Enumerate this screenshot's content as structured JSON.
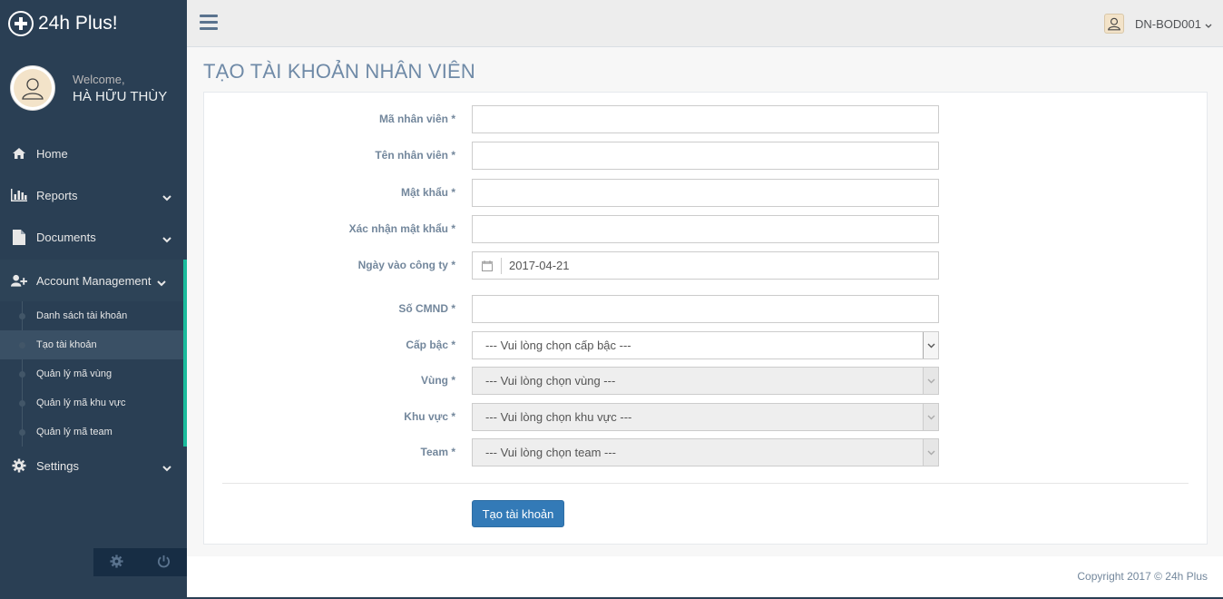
{
  "brand": {
    "title": "24h Plus!"
  },
  "profile": {
    "welcome": "Welcome,",
    "name": "HÀ HỮU THÙY"
  },
  "nav": {
    "home": "Home",
    "reports": "Reports",
    "documents": "Documents",
    "account": "Account Management",
    "settings": "Settings",
    "sub": [
      "Danh sách tài khoản",
      "Tạo tài khoản",
      "Quản lý mã vùng",
      "Quản lý mã khu vực",
      "Quản lý mã team"
    ]
  },
  "topnav": {
    "user": "DN-BOD001"
  },
  "page": {
    "title": "TẠO TÀI KHOẢN NHÂN VIÊN"
  },
  "form": {
    "ma_nv": {
      "label": "Mã nhân viên *",
      "value": ""
    },
    "ten_nv": {
      "label": "Tên nhân viên *",
      "value": ""
    },
    "mat_khau": {
      "label": "Mật khẩu *",
      "value": ""
    },
    "xac_nhan": {
      "label": "Xác nhận mật khẩu *",
      "value": ""
    },
    "ngay_vao": {
      "label": "Ngày vào công ty *",
      "value": "2017-04-21"
    },
    "cmnd": {
      "label": "Số CMND *",
      "value": ""
    },
    "cap_bac": {
      "label": "Cấp bậc *",
      "value": "--- Vui lòng chọn cấp bậc ---"
    },
    "vung": {
      "label": "Vùng *",
      "value": "--- Vui lòng chọn vùng ---"
    },
    "khu_vuc": {
      "label": "Khu vực *",
      "value": "--- Vui lòng chọn khu vực ---"
    },
    "team": {
      "label": "Team *",
      "value": "--- Vui lòng chọn team ---"
    },
    "submit": "Tạo tài khoản"
  },
  "footer": {
    "copyright": "Copyright 2017 © 24h Plus"
  },
  "colors": {
    "sidebar": "#2a3f54",
    "accent": "#1abb9c",
    "primary": "#337ab7"
  }
}
